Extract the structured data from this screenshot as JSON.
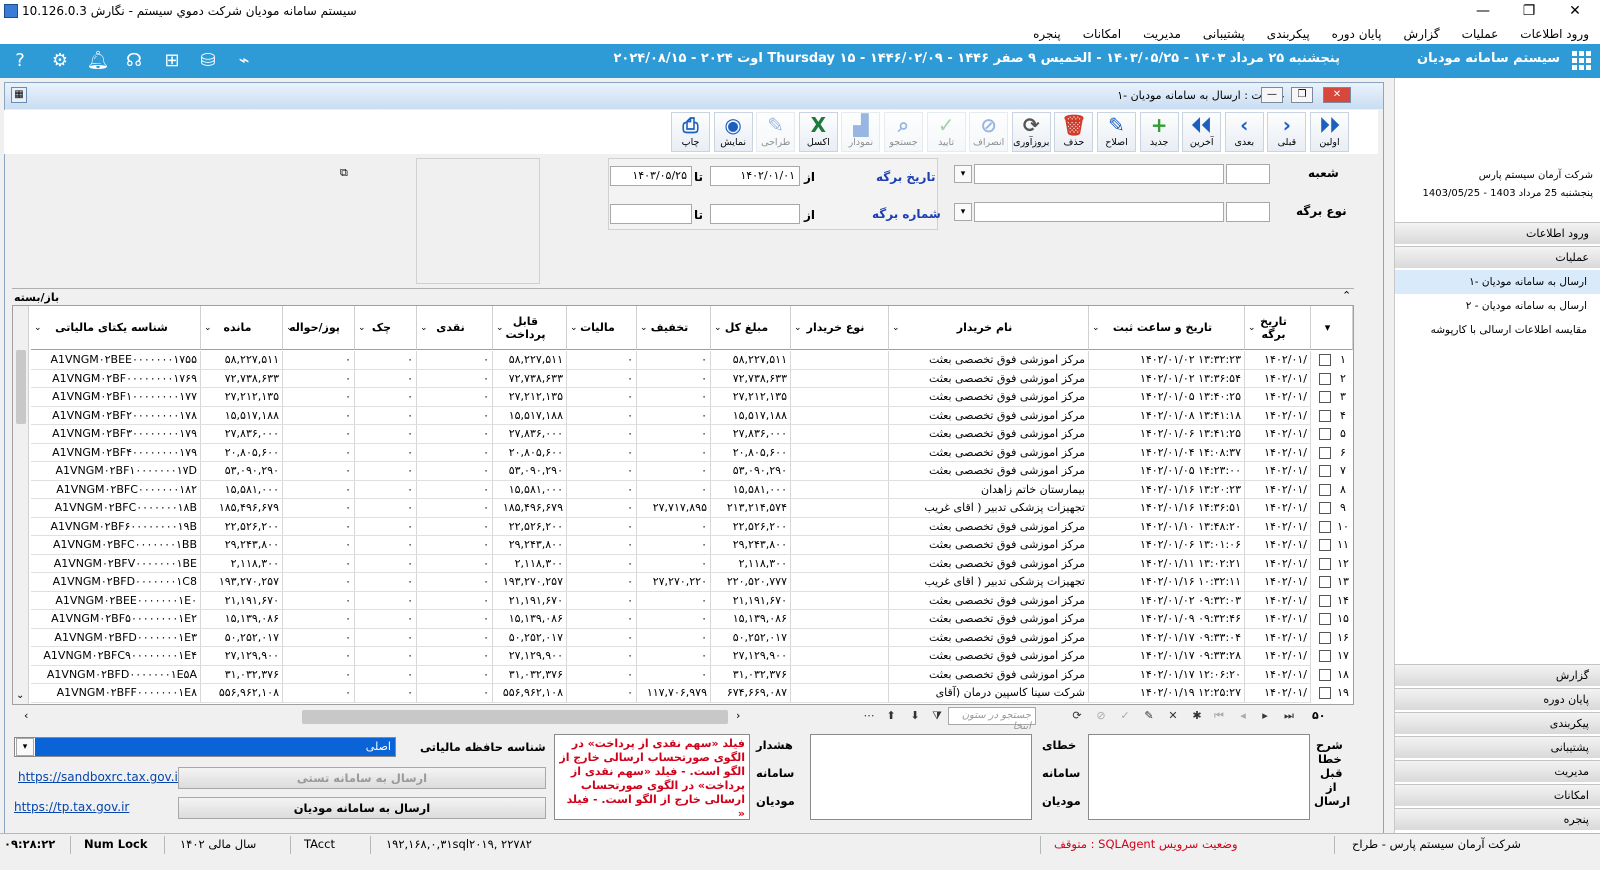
{
  "title_bar": {
    "title": "سیستم سامانه مودیان شرکت دموي سيستم - نگارش 10.126.0.3"
  },
  "menu": [
    "ورود اطلاعات",
    "عملیات",
    "گزارش",
    "پایان دوره",
    "پیکربندی",
    "پشتیبانی",
    "مدیریت",
    "امکانات",
    "پنجره"
  ],
  "header": {
    "system_name": "سیستم سامانه مودیان",
    "date_string": "پنجشنبه ۲۵ مرداد ۱۴۰۳ - ۱۴۰۳/۰۵/۲۵ - الخميس ۹ صفر ۱۴۴۶ - ۱۴۴۶/۰۲/۰۹ - Thursday ۱۵ اوت ۲۰۲۴ - ۲۰۲۴/۰۸/۱۵"
  },
  "right_panel": {
    "company": "شرکت آرمان سیستم پارس",
    "date": "پنجشنبه 25 مرداد 1403 - 1403/05/25",
    "section_top": [
      "ورود اطلاعات",
      "عملیات"
    ],
    "items": [
      "ارسال به سامانه مودیان -۱",
      "ارسال به سامانه مودیان - ۲",
      "مقایسه اطلاعات ارسالی با کارپوشه"
    ],
    "section_bottom": [
      "گزارش",
      "پایان دوره",
      "پیکربندی",
      "پشتیبانی",
      "مدیریت",
      "امکانات",
      "پنجره"
    ]
  },
  "window": {
    "title": "عملیات : ارسال به سامانه مودیان -۱",
    "toolbar": [
      {
        "label": "اولین",
        "icon": "⏵⏵",
        "color": "#1d5fbf",
        "enabled": true
      },
      {
        "label": "قبلی",
        "icon": "›",
        "color": "#1d5fbf",
        "enabled": true
      },
      {
        "label": "بعدی",
        "icon": "‹",
        "color": "#1d5fbf",
        "enabled": true
      },
      {
        "label": "آخرین",
        "icon": "⏴⏴",
        "color": "#1d5fbf",
        "enabled": true
      },
      {
        "label": "جدید",
        "icon": "+",
        "color": "#2f9e33",
        "enabled": true
      },
      {
        "label": "اصلاح",
        "icon": "✎",
        "color": "#1d5fbf",
        "enabled": true
      },
      {
        "label": "حذف",
        "icon": "🗑",
        "color": "#d23a2a",
        "enabled": true
      },
      {
        "label": "بروزآوری",
        "icon": "⟳",
        "color": "#555555",
        "enabled": true
      },
      {
        "label": "انصراف",
        "icon": "⊘",
        "color": "#1d5fbf",
        "enabled": false
      },
      {
        "label": "تایید",
        "icon": "✓",
        "color": "#2f9e33",
        "enabled": false
      },
      {
        "label": "جستجو",
        "icon": "⌕",
        "color": "#1d5fbf",
        "enabled": false
      },
      {
        "label": "نمودار",
        "icon": "▟",
        "color": "#1d5fbf",
        "enabled": false
      },
      {
        "label": "اکسل",
        "icon": "X",
        "color": "#1e7b3c",
        "enabled": true
      },
      {
        "label": "طراحی",
        "icon": "✎",
        "color": "#1d5fbf",
        "enabled": false
      },
      {
        "label": "نمایش",
        "icon": "◉",
        "color": "#1d5fbf",
        "enabled": true
      },
      {
        "label": "چاپ",
        "icon": "⎙",
        "color": "#1d5fbf",
        "enabled": true
      }
    ],
    "filters": {
      "branch_label": "شعبه",
      "form_type_label": "نوع برگه",
      "form_date_label": "تاریخ برگه",
      "form_number_label": "شماره برگه",
      "from_label": "از",
      "to_label": "تا",
      "date_from": "۱۴۰۲/۰۱/۰۱",
      "date_to": "۱۴۰۳/۰۵/۲۵"
    },
    "collapse_label": "باز/بسته",
    "columns": [
      "تاریخ برگه",
      "تاریخ و ساعت ثبت",
      "نام خریدار",
      "نوع خریدار",
      "مبلغ کل",
      "تخفیف",
      "مالیات",
      "قابل پرداخت",
      "نقدی",
      "چک",
      "پوز/حواله",
      "مانده",
      "شناسه یکتای مالیاتی"
    ],
    "rows": [
      {
        "n": "۱",
        "date": "۱۴۰۲/۰۱/",
        "reg": "۱۴۰۲/۰۱/۰۲ ۱۳:۳۲:۲۳",
        "buyer": "مرکز اموزشی فوق تخصصی بعثت",
        "type": "",
        "total": "۵۸,۲۲۷,۵۱۱",
        "disc": "۰",
        "tax": "۰",
        "pay": "۵۸,۲۲۷,۵۱۱",
        "cash": "۰",
        "check": "۰",
        "pos": "۰",
        "rem": "۵۸,۲۲۷,۵۱۱",
        "id": "A1VNGM۰۲BEE۰۰۰۰۰۰۰۱۷۵۵"
      },
      {
        "n": "۲",
        "date": "۱۴۰۲/۰۱/",
        "reg": "۱۴۰۲/۰۱/۰۲ ۱۳:۳۶:۵۴",
        "buyer": "مرکز اموزشی فوق تخصصی بعثت",
        "type": "",
        "total": "۷۲,۷۳۸,۶۳۳",
        "disc": "۰",
        "tax": "۰",
        "pay": "۷۲,۷۳۸,۶۳۳",
        "cash": "۰",
        "check": "۰",
        "pos": "۰",
        "rem": "۷۲,۷۳۸,۶۳۳",
        "id": "A1VNGM۰۲BF۰۰۰۰۰۰۰۰۱۷۶۹"
      },
      {
        "n": "۳",
        "date": "۱۴۰۲/۰۱/",
        "reg": "۱۴۰۲/۰۱/۰۵ ۱۳:۴۰:۲۵",
        "buyer": "مرکز اموزشی فوق تخصصی بعثت",
        "type": "",
        "total": "۲۷,۲۱۲,۱۳۵",
        "disc": "۰",
        "tax": "۰",
        "pay": "۲۷,۲۱۲,۱۳۵",
        "cash": "۰",
        "check": "۰",
        "pos": "۰",
        "rem": "۲۷,۲۱۲,۱۳۵",
        "id": "A1VNGM۰۲BF۱۰۰۰۰۰۰۰۰۱۷۷"
      },
      {
        "n": "۴",
        "date": "۱۴۰۲/۰۱/",
        "reg": "۱۴۰۲/۰۱/۰۸ ۱۳:۴۱:۱۸",
        "buyer": "مرکز اموزشی فوق تخصصی بعثت",
        "type": "",
        "total": "۱۵,۵۱۷,۱۸۸",
        "disc": "۰",
        "tax": "۰",
        "pay": "۱۵,۵۱۷,۱۸۸",
        "cash": "۰",
        "check": "۰",
        "pos": "۰",
        "rem": "۱۵,۵۱۷,۱۸۸",
        "id": "A1VNGM۰۲BF۲۰۰۰۰۰۰۰۰۱۷۸"
      },
      {
        "n": "۵",
        "date": "۱۴۰۲/۰۱/",
        "reg": "۱۴۰۲/۰۱/۰۶ ۱۳:۴۱:۲۵",
        "buyer": "مرکز اموزشی فوق تخصصی بعثت",
        "type": "",
        "total": "۲۷,۸۳۶,۰۰۰",
        "disc": "۰",
        "tax": "۰",
        "pay": "۲۷,۸۳۶,۰۰۰",
        "cash": "۰",
        "check": "۰",
        "pos": "۰",
        "rem": "۲۷,۸۳۶,۰۰۰",
        "id": "A1VNGM۰۲BF۳۰۰۰۰۰۰۰۰۱۷۹"
      },
      {
        "n": "۶",
        "date": "۱۴۰۲/۰۱/",
        "reg": "۱۴۰۲/۰۱/۰۴ ۱۴:۰۸:۳۷",
        "buyer": "مرکز اموزشی فوق تخصصی بعثت",
        "type": "",
        "total": "۲۰,۸۰۵,۶۰۰",
        "disc": "۰",
        "tax": "۰",
        "pay": "۲۰,۸۰۵,۶۰۰",
        "cash": "۰",
        "check": "۰",
        "pos": "۰",
        "rem": "۲۰,۸۰۵,۶۰۰",
        "id": "A1VNGM۰۲BF۴۰۰۰۰۰۰۰۰۱۷۹"
      },
      {
        "n": "۷",
        "date": "۱۴۰۲/۰۱/",
        "reg": "۱۴۰۲/۰۱/۰۵ ۱۴:۲۳:۰۰",
        "buyer": "مرکز اموزشی فوق تخصصی بعثت",
        "type": "",
        "total": "۵۳,۰۹۰,۲۹۰",
        "disc": "۰",
        "tax": "۰",
        "pay": "۵۳,۰۹۰,۲۹۰",
        "cash": "۰",
        "check": "۰",
        "pos": "۰",
        "rem": "۵۳,۰۹۰,۲۹۰",
        "id": "A1VNGM۰۲BF۱۰۰۰۰۰۰۰۱۷D"
      },
      {
        "n": "۸",
        "date": "۱۴۰۲/۰۱/",
        "reg": "۱۴۰۲/۰۱/۱۶ ۱۳:۲۰:۲۳",
        "buyer": "بیمارستان خاتم زاهدان",
        "type": "",
        "total": "۱۵,۵۸۱,۰۰۰",
        "disc": "۰",
        "tax": "۰",
        "pay": "۱۵,۵۸۱,۰۰۰",
        "cash": "۰",
        "check": "۰",
        "pos": "۰",
        "rem": "۱۵,۵۸۱,۰۰۰",
        "id": "A1VNGM۰۲BFC۰۰۰۰۰۰۰۱۸۲"
      },
      {
        "n": "۹",
        "date": "۱۴۰۲/۰۱/",
        "reg": "۱۴۰۲/۰۱/۱۶ ۱۴:۳۶:۵۱",
        "buyer": "تجهیزات پزشکی تدبیر ( اقای غریب",
        "type": "",
        "total": "۲۱۳,۲۱۴,۵۷۴",
        "disc": "۲۷,۷۱۷,۸۹۵",
        "tax": "۰",
        "pay": "۱۸۵,۴۹۶,۶۷۹",
        "cash": "۰",
        "check": "۰",
        "pos": "۰",
        "rem": "۱۸۵,۴۹۶,۶۷۹",
        "id": "A1VNGM۰۲BFC۰۰۰۰۰۰۰۱۸B"
      },
      {
        "n": "۱۰",
        "date": "۱۴۰۲/۰۱/",
        "reg": "۱۴۰۲/۰۱/۱۰ ۱۳:۴۸:۲۰",
        "buyer": "مرکز اموزشی فوق تخصصی بعثت",
        "type": "",
        "total": "۲۲,۵۲۶,۲۰۰",
        "disc": "۰",
        "tax": "۰",
        "pay": "۲۲,۵۲۶,۲۰۰",
        "cash": "۰",
        "check": "۰",
        "pos": "۰",
        "rem": "۲۲,۵۲۶,۲۰۰",
        "id": "A1VNGM۰۲BF۶۰۰۰۰۰۰۰۰۱۹B"
      },
      {
        "n": "۱۱",
        "date": "۱۴۰۲/۰۱/",
        "reg": "۱۴۰۲/۰۱/۰۶ ۱۳:۰۱:۰۶",
        "buyer": "مرکز اموزشی فوق تخصصی بعثت",
        "type": "",
        "total": "۲۹,۲۴۳,۸۰۰",
        "disc": "۰",
        "tax": "۰",
        "pay": "۲۹,۲۴۳,۸۰۰",
        "cash": "۰",
        "check": "۰",
        "pos": "۰",
        "rem": "۲۹,۲۴۳,۸۰۰",
        "id": "A1VNGM۰۲BFC۰۰۰۰۰۰۰۱BB"
      },
      {
        "n": "۱۲",
        "date": "۱۴۰۲/۰۱/",
        "reg": "۱۴۰۲/۰۱/۱۱ ۱۳:۰۲:۲۱",
        "buyer": "مرکز اموزشی فوق تخصصی بعثت",
        "type": "",
        "total": "۲,۱۱۸,۳۰۰",
        "disc": "۰",
        "tax": "۰",
        "pay": "۲,۱۱۸,۳۰۰",
        "cash": "۰",
        "check": "۰",
        "pos": "۰",
        "rem": "۲,۱۱۸,۳۰۰",
        "id": "A1VNGM۰۲BFV۰۰۰۰۰۰۰۱BE"
      },
      {
        "n": "۱۳",
        "date": "۱۴۰۲/۰۱/",
        "reg": "۱۴۰۲/۰۱/۱۶ ۱۰:۳۲:۱۱",
        "buyer": "تجهیزات پزشکی تدبیر ( اقای غریب",
        "type": "",
        "total": "۲۲۰,۵۲۰,۷۷۷",
        "disc": "۲۷,۲۷۰,۲۲۰",
        "tax": "۰",
        "pay": "۱۹۳,۲۷۰,۲۵۷",
        "cash": "۰",
        "check": "۰",
        "pos": "۰",
        "rem": "۱۹۳,۲۷۰,۲۵۷",
        "id": "A1VNGM۰۲BFD۰۰۰۰۰۰۰۱C8"
      },
      {
        "n": "۱۴",
        "date": "۱۴۰۲/۰۱/",
        "reg": "۱۴۰۲/۰۱/۰۲ ۰۹:۳۲:۰۳",
        "buyer": "مرکز اموزشی فوق تخصصی بعثت",
        "type": "",
        "total": "۲۱,۱۹۱,۶۷۰",
        "disc": "۰",
        "tax": "۰",
        "pay": "۲۱,۱۹۱,۶۷۰",
        "cash": "۰",
        "check": "۰",
        "pos": "۰",
        "rem": "۲۱,۱۹۱,۶۷۰",
        "id": "A1VNGM۰۲BEE۰۰۰۰۰۰۰۱E۰"
      },
      {
        "n": "۱۵",
        "date": "۱۴۰۲/۰۱/",
        "reg": "۱۴۰۲/۰۱/۰۹ ۰۹:۳۲:۴۶",
        "buyer": "مرکز اموزشی فوق تخصصی بعثت",
        "type": "",
        "total": "۱۵,۱۳۹,۰۸۶",
        "disc": "۰",
        "tax": "۰",
        "pay": "۱۵,۱۳۹,۰۸۶",
        "cash": "۰",
        "check": "۰",
        "pos": "۰",
        "rem": "۱۵,۱۳۹,۰۸۶",
        "id": "A1VNGM۰۲BF۵۰۰۰۰۰۰۰۰۱E۲"
      },
      {
        "n": "۱۶",
        "date": "۱۴۰۲/۰۱/",
        "reg": "۱۴۰۲/۰۱/۱۷ ۰۹:۳۳:۰۴",
        "buyer": "مرکز اموزشی فوق تخصصی بعثت",
        "type": "",
        "total": "۵۰,۲۵۲,۰۱۷",
        "disc": "۰",
        "tax": "۰",
        "pay": "۵۰,۲۵۲,۰۱۷",
        "cash": "۰",
        "check": "۰",
        "pos": "۰",
        "rem": "۵۰,۲۵۲,۰۱۷",
        "id": "A1VNGM۰۲BFD۰۰۰۰۰۰۰۱E۳"
      },
      {
        "n": "۱۷",
        "date": "۱۴۰۲/۰۱/",
        "reg": "۱۴۰۲/۰۱/۱۷ ۰۹:۳۳:۲۸",
        "buyer": "مرکز اموزشی فوق تخصصی بعثت",
        "type": "",
        "total": "۲۷,۱۲۹,۹۰۰",
        "disc": "۰",
        "tax": "۰",
        "pay": "۲۷,۱۲۹,۹۰۰",
        "cash": "۰",
        "check": "۰",
        "pos": "۰",
        "rem": "۲۷,۱۲۹,۹۰۰",
        "id": "A1VNGM۰۲BFC۹۰۰۰۰۰۰۰۰۱E۴"
      },
      {
        "n": "۱۸",
        "date": "۱۴۰۲/۰۱/",
        "reg": "۱۴۰۲/۰۱/۱۷ ۱۲:۰۶:۲۰",
        "buyer": "مرکز اموزشی فوق تخصصی بعثت",
        "type": "",
        "total": "۳۱,۰۳۲,۳۷۶",
        "disc": "۰",
        "tax": "۰",
        "pay": "۳۱,۰۳۲,۳۷۶",
        "cash": "۰",
        "check": "۰",
        "pos": "۰",
        "rem": "۳۱,۰۳۲,۳۷۶",
        "id": "A1VNGM۰۲BFD۰۰۰۰۰۰۰۱E۵A"
      },
      {
        "n": "۱۹",
        "date": "۱۴۰۲/۰۱/",
        "reg": "۱۴۰۲/۰۱/۱۹ ۱۲:۲۵:۲۷",
        "buyer": "شرکت سینا کاسپین درمان (آقای",
        "type": "",
        "total": "۶۷۴,۶۶۹,۰۸۷",
        "disc": "۱۱۷,۷۰۶,۹۷۹",
        "tax": "۰",
        "pay": "۵۵۶,۹۶۲,۱۰۸",
        "cash": "۰",
        "check": "۰",
        "pos": "۰",
        "rem": "۵۵۶,۹۶۲,۱۰۸",
        "id": "A1VNGM۰۲BFF۰۰۰۰۰۰۰۱E۸"
      }
    ],
    "grid_nav": {
      "count": "۵۰",
      "search_placeholder": "جستجو در ستون انتخا"
    },
    "bottom": {
      "tax_memory_label": "شناسه حافظه مالیاتی",
      "tax_memory_value": "اصلی",
      "link1": "https://sandboxrc.tax.gov.ir",
      "link2": "https://tp.tax.gov.ir",
      "btn_test": "ارسال به سامانه تستی",
      "btn_send": "ارسال به سامانه مودیان",
      "error_text": "فیلد «سهم نقدی از پرداخت» در الگوی صورتحساب ارسالی خارج از الگو است. - فیلد «سهم نقدی از پرداخت» در الگوی صورتحساب ارسالی خارج از الگو است. - فیلد «",
      "warn_labels": [
        "هشدار",
        "سامانه",
        "مودیان"
      ],
      "err_labels": [
        "خطای",
        "سامانه",
        "مودیان"
      ],
      "desc_labels": [
        "شرح",
        "خطا",
        "قبل",
        "از",
        "ارسال"
      ]
    }
  },
  "status_bar": {
    "company": "شرکت آرمان سیستم پارس - طراح",
    "sqlagent": "وضعیت سرویس SQLAgent : متوقف",
    "server": "۱۹۲,۱۶۸,۰,۳۱sql۲۰۱۹, ۲۲۷۸۲",
    "db": "TAcct",
    "fiscal": "سال مالی ۱۴۰۲",
    "numlock": "Num Lock",
    "time": "۰۹:۲۸:۲۲"
  }
}
